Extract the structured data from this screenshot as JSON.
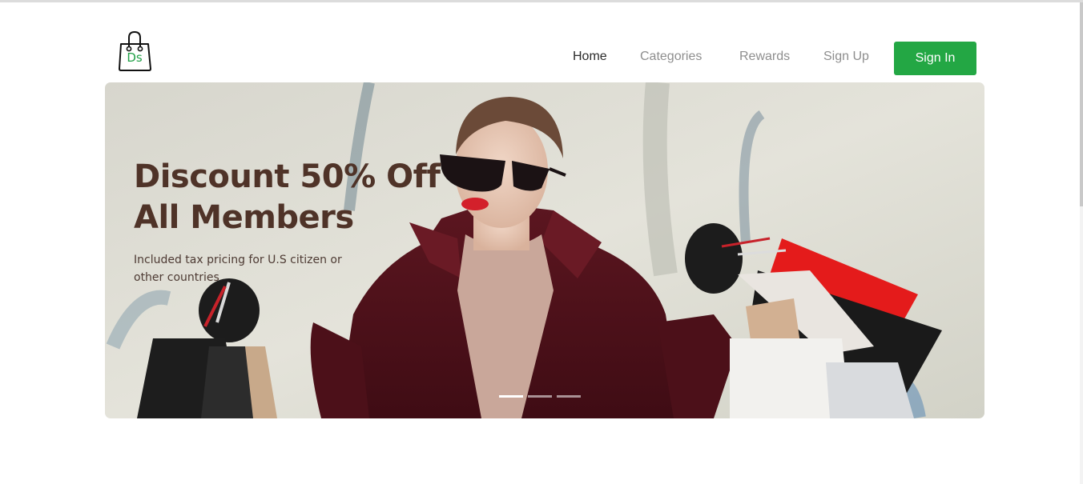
{
  "brand": {
    "logo_text": "Ds",
    "accent_color": "#23a744"
  },
  "nav": {
    "items": [
      {
        "label": "Home",
        "active": true
      },
      {
        "label": "Categories",
        "active": false
      },
      {
        "label": "Rewards",
        "active": false
      },
      {
        "label": "Sign Up",
        "active": false
      }
    ],
    "sign_in_label": "Sign In"
  },
  "hero": {
    "title_line1": "Discount 50% Off",
    "title_line2": "All Members",
    "subtitle": "Included tax pricing for U.S citizen or other countries",
    "slides": {
      "count": 3,
      "active_index": 0
    },
    "title_color": "#4f3328"
  }
}
